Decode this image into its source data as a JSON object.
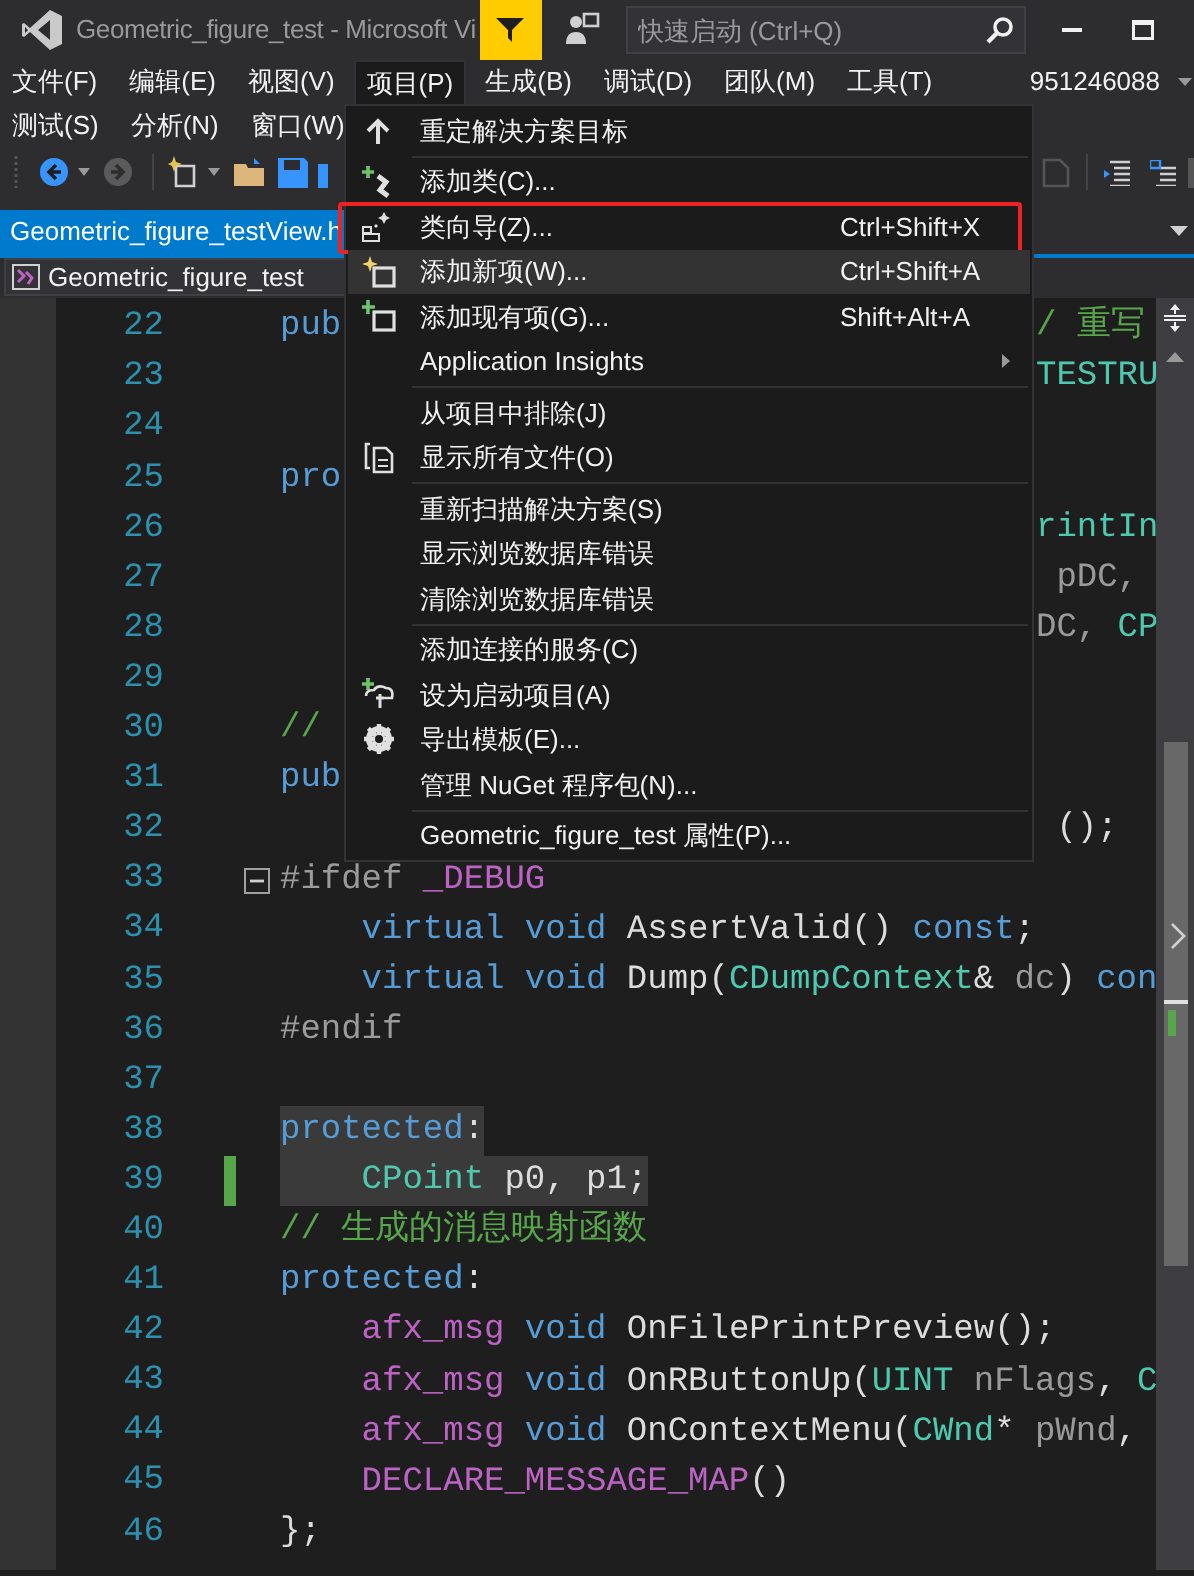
{
  "window": {
    "title": "Geometric_figure_test - Microsoft Vi"
  },
  "quick_launch": {
    "placeholder": "快速启动 (Ctrl+Q)"
  },
  "menu_bar": {
    "rows": [
      [
        {
          "label": "文件(F)",
          "selected": false
        },
        {
          "label": "编辑(E)",
          "selected": false
        },
        {
          "label": "视图(V)",
          "selected": false
        },
        {
          "label": "项目(P)",
          "selected": true
        },
        {
          "label": "生成(B)",
          "selected": false
        },
        {
          "label": "调试(D)",
          "selected": false
        },
        {
          "label": "团队(M)",
          "selected": false
        },
        {
          "label": "工具(T)",
          "selected": false
        }
      ],
      [
        {
          "label": "测试(S)",
          "selected": false
        },
        {
          "label": "分析(N)",
          "selected": false
        },
        {
          "label": "窗口(W)",
          "selected": false
        }
      ]
    ],
    "account": "951246088"
  },
  "tabs": [
    {
      "label": "Geometric_figure_testView.h",
      "selected": true
    }
  ],
  "navigation_bar": {
    "scope": "Geometric_figure_test"
  },
  "editor": {
    "lines": [
      {
        "number": "22",
        "changed": false,
        "highlighted": false,
        "left": [
          {
            "kind": "keyword",
            "text": "pub"
          }
        ],
        "right": [
          {
            "kind": "comment",
            "text": "/ 重写"
          }
        ]
      },
      {
        "number": "23",
        "changed": false,
        "highlighted": false,
        "right": [
          {
            "kind": "type",
            "text": "TESTRU"
          }
        ]
      },
      {
        "number": "24",
        "changed": false,
        "highlighted": false
      },
      {
        "number": "25",
        "changed": false,
        "highlighted": false,
        "left": [
          {
            "kind": "keyword",
            "text": "pro"
          }
        ]
      },
      {
        "number": "26",
        "changed": false,
        "highlighted": false,
        "right": [
          {
            "kind": "type",
            "text": "rintIn"
          }
        ]
      },
      {
        "number": "27",
        "changed": false,
        "highlighted": false,
        "right": [
          {
            "kind": "param",
            "text": " pDC,"
          }
        ]
      },
      {
        "number": "28",
        "changed": false,
        "highlighted": false,
        "right": [
          {
            "kind": "param",
            "text": "DC,"
          },
          {
            "kind": "type",
            "text": " CP"
          }
        ]
      },
      {
        "number": "29",
        "changed": false,
        "highlighted": false
      },
      {
        "number": "30",
        "changed": false,
        "highlighted": false,
        "left": [
          {
            "kind": "comment",
            "text": "//"
          }
        ]
      },
      {
        "number": "31",
        "changed": false,
        "highlighted": false,
        "left": [
          {
            "kind": "keyword",
            "text": "pub"
          }
        ]
      },
      {
        "number": "32",
        "changed": false,
        "highlighted": false,
        "right": [
          {
            "kind": "plain",
            "text": " ();"
          }
        ]
      },
      {
        "number": "33",
        "changed": false,
        "highlighted": false,
        "expanded": true,
        "tokens": [
          {
            "kind": "preproc",
            "text": "#ifdef "
          },
          {
            "kind": "macro",
            "text": "_DEBUG"
          }
        ]
      },
      {
        "number": "34",
        "changed": false,
        "highlighted": false,
        "tokens": [
          {
            "kind": "keyword",
            "text": "    virtual void"
          },
          {
            "kind": "plain",
            "text": " AssertValid() "
          },
          {
            "kind": "keyword",
            "text": "const"
          },
          {
            "kind": "plain",
            "text": ";"
          }
        ]
      },
      {
        "number": "35",
        "changed": false,
        "highlighted": false,
        "tokens": [
          {
            "kind": "keyword",
            "text": "    virtual void"
          },
          {
            "kind": "plain",
            "text": " Dump("
          },
          {
            "kind": "type",
            "text": "CDumpContext"
          },
          {
            "kind": "plain",
            "text": "& "
          },
          {
            "kind": "param",
            "text": "dc"
          },
          {
            "kind": "plain",
            "text": ") "
          },
          {
            "kind": "keyword",
            "text": "con"
          }
        ]
      },
      {
        "number": "36",
        "changed": false,
        "highlighted": false,
        "tokens": [
          {
            "kind": "preproc",
            "text": "#endif"
          }
        ]
      },
      {
        "number": "37",
        "changed": false,
        "highlighted": false
      },
      {
        "number": "38",
        "changed": false,
        "highlighted": true,
        "tokens": [
          {
            "kind": "keyword",
            "text": "protected"
          },
          {
            "kind": "plain",
            "text": ":"
          }
        ]
      },
      {
        "number": "39",
        "changed": true,
        "highlighted": true,
        "tokens": [
          {
            "kind": "type",
            "text": "    CPoint"
          },
          {
            "kind": "plain",
            "text": " p0, p1;"
          }
        ]
      },
      {
        "number": "40",
        "changed": false,
        "highlighted": false,
        "tokens": [
          {
            "kind": "comment",
            "text": "// 生成的消息映射函数"
          }
        ]
      },
      {
        "number": "41",
        "changed": false,
        "highlighted": false,
        "tokens": [
          {
            "kind": "keyword",
            "text": "protected"
          },
          {
            "kind": "plain",
            "text": ":"
          }
        ]
      },
      {
        "number": "42",
        "changed": false,
        "highlighted": false,
        "tokens": [
          {
            "kind": "macro",
            "text": "    afx_msg"
          },
          {
            "kind": "keyword",
            "text": " void"
          },
          {
            "kind": "plain",
            "text": " OnFilePrintPreview();"
          }
        ]
      },
      {
        "number": "43",
        "changed": false,
        "highlighted": false,
        "tokens": [
          {
            "kind": "macro",
            "text": "    afx_msg"
          },
          {
            "kind": "keyword",
            "text": " void"
          },
          {
            "kind": "plain",
            "text": " OnRButtonUp("
          },
          {
            "kind": "type",
            "text": "UINT"
          },
          {
            "kind": "param",
            "text": " nFlags"
          },
          {
            "kind": "plain",
            "text": ", "
          },
          {
            "kind": "type",
            "text": "C"
          }
        ]
      },
      {
        "number": "44",
        "changed": false,
        "highlighted": false,
        "tokens": [
          {
            "kind": "macro",
            "text": "    afx_msg"
          },
          {
            "kind": "keyword",
            "text": " void"
          },
          {
            "kind": "plain",
            "text": " OnContextMenu("
          },
          {
            "kind": "type",
            "text": "CWnd"
          },
          {
            "kind": "plain",
            "text": "* "
          },
          {
            "kind": "param",
            "text": "pWnd"
          },
          {
            "kind": "plain",
            "text": ","
          }
        ]
      },
      {
        "number": "45",
        "changed": false,
        "highlighted": false,
        "tokens": [
          {
            "kind": "macro",
            "text": "    DECLARE_MESSAGE_MAP"
          },
          {
            "kind": "plain",
            "text": "()"
          }
        ]
      },
      {
        "number": "46",
        "changed": false,
        "highlighted": false,
        "tokens": [
          {
            "kind": "plain",
            "text": "};"
          }
        ]
      }
    ]
  },
  "context_menu": {
    "items": [
      {
        "kind": "item",
        "label": "重定解决方案目标",
        "selected": false,
        "outlined": false,
        "submenu": false
      },
      {
        "kind": "separator"
      },
      {
        "kind": "item",
        "label": "添加类(C)...",
        "selected": false,
        "outlined": false,
        "submenu": false
      },
      {
        "kind": "item",
        "label": "类向导(Z)...",
        "shortcut": "Ctrl+Shift+X",
        "selected": false,
        "outlined": true,
        "submenu": false
      },
      {
        "kind": "item",
        "label": "添加新项(W)...",
        "shortcut": "Ctrl+Shift+A",
        "selected": true,
        "outlined": false,
        "submenu": false
      },
      {
        "kind": "item",
        "label": "添加现有项(G)...",
        "shortcut": "Shift+Alt+A",
        "selected": false,
        "outlined": false,
        "submenu": false
      },
      {
        "kind": "item",
        "label": "Application Insights",
        "selected": false,
        "outlined": false,
        "submenu": true
      },
      {
        "kind": "separator"
      },
      {
        "kind": "item",
        "label": "从项目中排除(J)",
        "selected": false,
        "outlined": false,
        "submenu": false
      },
      {
        "kind": "item",
        "label": "显示所有文件(O)",
        "selected": false,
        "outlined": false,
        "submenu": false
      },
      {
        "kind": "separator"
      },
      {
        "kind": "item",
        "label": "重新扫描解决方案(S)",
        "selected": false,
        "outlined": false,
        "submenu": false
      },
      {
        "kind": "item",
        "label": "显示浏览数据库错误",
        "selected": false,
        "outlined": false,
        "submenu": false
      },
      {
        "kind": "item",
        "label": "清除浏览数据库错误",
        "selected": false,
        "outlined": false,
        "submenu": false
      },
      {
        "kind": "separator"
      },
      {
        "kind": "item",
        "label": "添加连接的服务(C)",
        "selected": false,
        "outlined": false,
        "submenu": false
      },
      {
        "kind": "item",
        "label": "设为启动项目(A)",
        "selected": false,
        "outlined": false,
        "submenu": false
      },
      {
        "kind": "item",
        "label": "导出模板(E)...",
        "selected": false,
        "outlined": false,
        "submenu": false
      },
      {
        "kind": "item",
        "label": "管理 NuGet 程序包(N)...",
        "selected": false,
        "outlined": false,
        "submenu": false
      },
      {
        "kind": "separator"
      },
      {
        "kind": "item",
        "label": "Geometric_figure_test 属性(P)...",
        "selected": false,
        "outlined": false,
        "submenu": false
      }
    ]
  }
}
